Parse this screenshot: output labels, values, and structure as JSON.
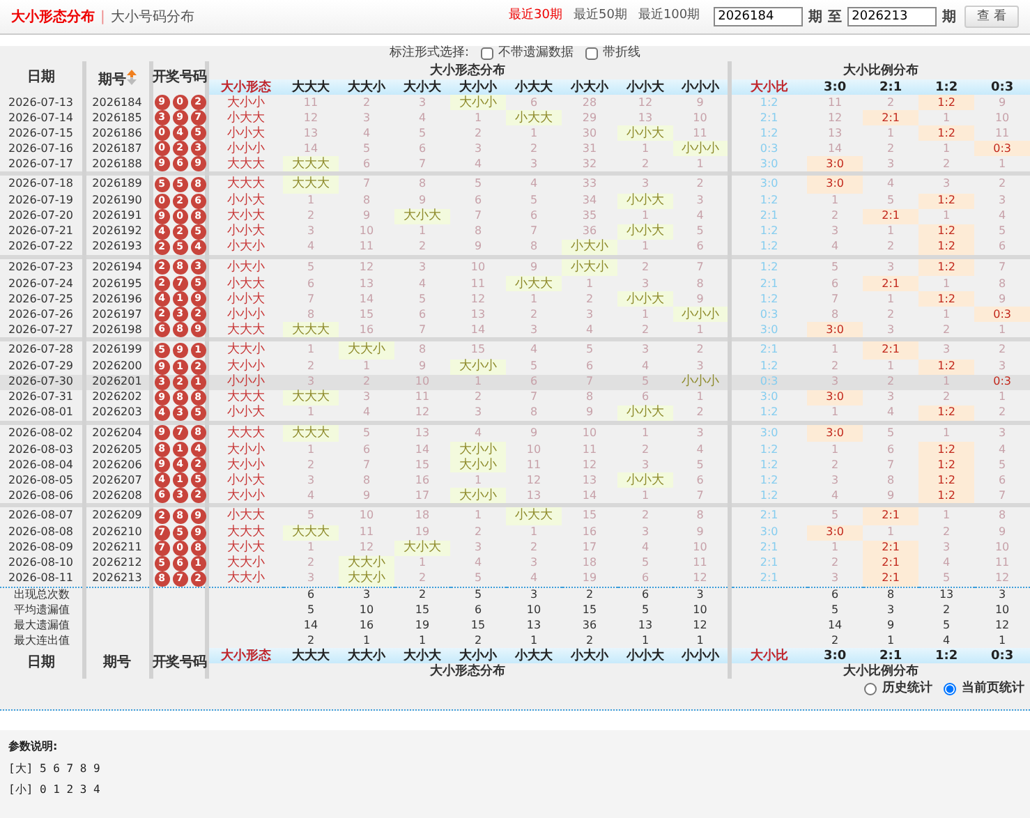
{
  "tabs": [
    {
      "label": "大小形态分布",
      "selected": true
    },
    {
      "label": "大小号码分布",
      "selected": false
    }
  ],
  "tab_separator": "|",
  "range": {
    "links": [
      {
        "label": "最近30期",
        "selected": true
      },
      {
        "label": "最近50期",
        "selected": false
      },
      {
        "label": "最近100期",
        "selected": false
      }
    ],
    "from": "2026184",
    "from_unit": "期",
    "to_label": "至",
    "to": "2026213",
    "to_unit": "期",
    "button": "查 看"
  },
  "options": {
    "label": "标注形式选择:",
    "checkboxes": [
      {
        "label": "不带遗漏数据",
        "checked": false
      },
      {
        "label": "带折线",
        "checked": false
      }
    ]
  },
  "table": {
    "date_header": "日期",
    "issue_header": "期号",
    "balls_header": "开奖号码",
    "group_1": "大小形态分布",
    "group_1_columns": [
      "大小形态",
      "大大大",
      "大大小",
      "大小大",
      "大小小",
      "小大大",
      "小大小",
      "小小大",
      "小小小"
    ],
    "group_2": "大小比例分布",
    "group_2_columns": [
      "大小比",
      "3:0",
      "2:1",
      "1:2",
      "0:3"
    ],
    "rows": [
      {
        "date": "2026-07-13",
        "issue": "2026184",
        "balls": [
          "9",
          "0",
          "2"
        ],
        "pattern": "大小小",
        "highlighted": false,
        "pattern_cells": [
          {
            "text": "11",
            "hit": false
          },
          {
            "text": "2",
            "hit": false
          },
          {
            "text": "3",
            "hit": false
          },
          {
            "text": "大小小",
            "hit": true
          },
          {
            "text": "6",
            "hit": false
          },
          {
            "text": "28",
            "hit": false
          },
          {
            "text": "12",
            "hit": false
          },
          {
            "text": "9",
            "hit": false
          }
        ],
        "ratio": "1:2",
        "ratio_cells": [
          {
            "text": "11",
            "hit": false
          },
          {
            "text": "2",
            "hit": false
          },
          {
            "text": "1:2",
            "hit": true
          },
          {
            "text": "9",
            "hit": false
          }
        ]
      },
      {
        "date": "2026-07-14",
        "issue": "2026185",
        "balls": [
          "3",
          "9",
          "7"
        ],
        "pattern": "小大大",
        "highlighted": false,
        "pattern_cells": [
          {
            "text": "12",
            "hit": false
          },
          {
            "text": "3",
            "hit": false
          },
          {
            "text": "4",
            "hit": false
          },
          {
            "text": "1",
            "hit": false
          },
          {
            "text": "小大大",
            "hit": true
          },
          {
            "text": "29",
            "hit": false
          },
          {
            "text": "13",
            "hit": false
          },
          {
            "text": "10",
            "hit": false
          }
        ],
        "ratio": "2:1",
        "ratio_cells": [
          {
            "text": "12",
            "hit": false
          },
          {
            "text": "2:1",
            "hit": true
          },
          {
            "text": "1",
            "hit": false
          },
          {
            "text": "10",
            "hit": false
          }
        ]
      },
      {
        "date": "2026-07-15",
        "issue": "2026186",
        "balls": [
          "0",
          "4",
          "5"
        ],
        "pattern": "小小大",
        "highlighted": false,
        "pattern_cells": [
          {
            "text": "13",
            "hit": false
          },
          {
            "text": "4",
            "hit": false
          },
          {
            "text": "5",
            "hit": false
          },
          {
            "text": "2",
            "hit": false
          },
          {
            "text": "1",
            "hit": false
          },
          {
            "text": "30",
            "hit": false
          },
          {
            "text": "小小大",
            "hit": true
          },
          {
            "text": "11",
            "hit": false
          }
        ],
        "ratio": "1:2",
        "ratio_cells": [
          {
            "text": "13",
            "hit": false
          },
          {
            "text": "1",
            "hit": false
          },
          {
            "text": "1:2",
            "hit": true
          },
          {
            "text": "11",
            "hit": false
          }
        ]
      },
      {
        "date": "2026-07-16",
        "issue": "2026187",
        "balls": [
          "0",
          "2",
          "3"
        ],
        "pattern": "小小小",
        "highlighted": false,
        "pattern_cells": [
          {
            "text": "14",
            "hit": false
          },
          {
            "text": "5",
            "hit": false
          },
          {
            "text": "6",
            "hit": false
          },
          {
            "text": "3",
            "hit": false
          },
          {
            "text": "2",
            "hit": false
          },
          {
            "text": "31",
            "hit": false
          },
          {
            "text": "1",
            "hit": false
          },
          {
            "text": "小小小",
            "hit": true
          }
        ],
        "ratio": "0:3",
        "ratio_cells": [
          {
            "text": "14",
            "hit": false
          },
          {
            "text": "2",
            "hit": false
          },
          {
            "text": "1",
            "hit": false
          },
          {
            "text": "0:3",
            "hit": true
          }
        ]
      },
      {
        "date": "2026-07-17",
        "issue": "2026188",
        "balls": [
          "9",
          "6",
          "9"
        ],
        "pattern": "大大大",
        "highlighted": false,
        "pattern_cells": [
          {
            "text": "大大大",
            "hit": true
          },
          {
            "text": "6",
            "hit": false
          },
          {
            "text": "7",
            "hit": false
          },
          {
            "text": "4",
            "hit": false
          },
          {
            "text": "3",
            "hit": false
          },
          {
            "text": "32",
            "hit": false
          },
          {
            "text": "2",
            "hit": false
          },
          {
            "text": "1",
            "hit": false
          }
        ],
        "ratio": "3:0",
        "ratio_cells": [
          {
            "text": "3:0",
            "hit": true
          },
          {
            "text": "3",
            "hit": false
          },
          {
            "text": "2",
            "hit": false
          },
          {
            "text": "1",
            "hit": false
          }
        ]
      },
      {
        "date": "2026-07-18",
        "issue": "2026189",
        "balls": [
          "5",
          "5",
          "8"
        ],
        "pattern": "大大大",
        "highlighted": false,
        "pattern_cells": [
          {
            "text": "大大大",
            "hit": true
          },
          {
            "text": "7",
            "hit": false
          },
          {
            "text": "8",
            "hit": false
          },
          {
            "text": "5",
            "hit": false
          },
          {
            "text": "4",
            "hit": false
          },
          {
            "text": "33",
            "hit": false
          },
          {
            "text": "3",
            "hit": false
          },
          {
            "text": "2",
            "hit": false
          }
        ],
        "ratio": "3:0",
        "ratio_cells": [
          {
            "text": "3:0",
            "hit": true
          },
          {
            "text": "4",
            "hit": false
          },
          {
            "text": "3",
            "hit": false
          },
          {
            "text": "2",
            "hit": false
          }
        ]
      },
      {
        "date": "2026-07-19",
        "issue": "2026190",
        "balls": [
          "0",
          "2",
          "6"
        ],
        "pattern": "小小大",
        "highlighted": false,
        "pattern_cells": [
          {
            "text": "1",
            "hit": false
          },
          {
            "text": "8",
            "hit": false
          },
          {
            "text": "9",
            "hit": false
          },
          {
            "text": "6",
            "hit": false
          },
          {
            "text": "5",
            "hit": false
          },
          {
            "text": "34",
            "hit": false
          },
          {
            "text": "小小大",
            "hit": true
          },
          {
            "text": "3",
            "hit": false
          }
        ],
        "ratio": "1:2",
        "ratio_cells": [
          {
            "text": "1",
            "hit": false
          },
          {
            "text": "5",
            "hit": false
          },
          {
            "text": "1:2",
            "hit": true
          },
          {
            "text": "3",
            "hit": false
          }
        ]
      },
      {
        "date": "2026-07-20",
        "issue": "2026191",
        "balls": [
          "9",
          "0",
          "8"
        ],
        "pattern": "大小大",
        "highlighted": false,
        "pattern_cells": [
          {
            "text": "2",
            "hit": false
          },
          {
            "text": "9",
            "hit": false
          },
          {
            "text": "大小大",
            "hit": true
          },
          {
            "text": "7",
            "hit": false
          },
          {
            "text": "6",
            "hit": false
          },
          {
            "text": "35",
            "hit": false
          },
          {
            "text": "1",
            "hit": false
          },
          {
            "text": "4",
            "hit": false
          }
        ],
        "ratio": "2:1",
        "ratio_cells": [
          {
            "text": "2",
            "hit": false
          },
          {
            "text": "2:1",
            "hit": true
          },
          {
            "text": "1",
            "hit": false
          },
          {
            "text": "4",
            "hit": false
          }
        ]
      },
      {
        "date": "2026-07-21",
        "issue": "2026192",
        "balls": [
          "4",
          "2",
          "5"
        ],
        "pattern": "小小大",
        "highlighted": false,
        "pattern_cells": [
          {
            "text": "3",
            "hit": false
          },
          {
            "text": "10",
            "hit": false
          },
          {
            "text": "1",
            "hit": false
          },
          {
            "text": "8",
            "hit": false
          },
          {
            "text": "7",
            "hit": false
          },
          {
            "text": "36",
            "hit": false
          },
          {
            "text": "小小大",
            "hit": true
          },
          {
            "text": "5",
            "hit": false
          }
        ],
        "ratio": "1:2",
        "ratio_cells": [
          {
            "text": "3",
            "hit": false
          },
          {
            "text": "1",
            "hit": false
          },
          {
            "text": "1:2",
            "hit": true
          },
          {
            "text": "5",
            "hit": false
          }
        ]
      },
      {
        "date": "2026-07-22",
        "issue": "2026193",
        "balls": [
          "2",
          "5",
          "4"
        ],
        "pattern": "小大小",
        "highlighted": false,
        "pattern_cells": [
          {
            "text": "4",
            "hit": false
          },
          {
            "text": "11",
            "hit": false
          },
          {
            "text": "2",
            "hit": false
          },
          {
            "text": "9",
            "hit": false
          },
          {
            "text": "8",
            "hit": false
          },
          {
            "text": "小大小",
            "hit": true
          },
          {
            "text": "1",
            "hit": false
          },
          {
            "text": "6",
            "hit": false
          }
        ],
        "ratio": "1:2",
        "ratio_cells": [
          {
            "text": "4",
            "hit": false
          },
          {
            "text": "2",
            "hit": false
          },
          {
            "text": "1:2",
            "hit": true
          },
          {
            "text": "6",
            "hit": false
          }
        ]
      },
      {
        "date": "2026-07-23",
        "issue": "2026194",
        "balls": [
          "2",
          "8",
          "3"
        ],
        "pattern": "小大小",
        "highlighted": false,
        "pattern_cells": [
          {
            "text": "5",
            "hit": false
          },
          {
            "text": "12",
            "hit": false
          },
          {
            "text": "3",
            "hit": false
          },
          {
            "text": "10",
            "hit": false
          },
          {
            "text": "9",
            "hit": false
          },
          {
            "text": "小大小",
            "hit": true
          },
          {
            "text": "2",
            "hit": false
          },
          {
            "text": "7",
            "hit": false
          }
        ],
        "ratio": "1:2",
        "ratio_cells": [
          {
            "text": "5",
            "hit": false
          },
          {
            "text": "3",
            "hit": false
          },
          {
            "text": "1:2",
            "hit": true
          },
          {
            "text": "7",
            "hit": false
          }
        ]
      },
      {
        "date": "2026-07-24",
        "issue": "2026195",
        "balls": [
          "2",
          "7",
          "5"
        ],
        "pattern": "小大大",
        "highlighted": false,
        "pattern_cells": [
          {
            "text": "6",
            "hit": false
          },
          {
            "text": "13",
            "hit": false
          },
          {
            "text": "4",
            "hit": false
          },
          {
            "text": "11",
            "hit": false
          },
          {
            "text": "小大大",
            "hit": true
          },
          {
            "text": "1",
            "hit": false
          },
          {
            "text": "3",
            "hit": false
          },
          {
            "text": "8",
            "hit": false
          }
        ],
        "ratio": "2:1",
        "ratio_cells": [
          {
            "text": "6",
            "hit": false
          },
          {
            "text": "2:1",
            "hit": true
          },
          {
            "text": "1",
            "hit": false
          },
          {
            "text": "8",
            "hit": false
          }
        ]
      },
      {
        "date": "2026-07-25",
        "issue": "2026196",
        "balls": [
          "4",
          "1",
          "9"
        ],
        "pattern": "小小大",
        "highlighted": false,
        "pattern_cells": [
          {
            "text": "7",
            "hit": false
          },
          {
            "text": "14",
            "hit": false
          },
          {
            "text": "5",
            "hit": false
          },
          {
            "text": "12",
            "hit": false
          },
          {
            "text": "1",
            "hit": false
          },
          {
            "text": "2",
            "hit": false
          },
          {
            "text": "小小大",
            "hit": true
          },
          {
            "text": "9",
            "hit": false
          }
        ],
        "ratio": "1:2",
        "ratio_cells": [
          {
            "text": "7",
            "hit": false
          },
          {
            "text": "1",
            "hit": false
          },
          {
            "text": "1:2",
            "hit": true
          },
          {
            "text": "9",
            "hit": false
          }
        ]
      },
      {
        "date": "2026-07-26",
        "issue": "2026197",
        "balls": [
          "2",
          "3",
          "2"
        ],
        "pattern": "小小小",
        "highlighted": false,
        "pattern_cells": [
          {
            "text": "8",
            "hit": false
          },
          {
            "text": "15",
            "hit": false
          },
          {
            "text": "6",
            "hit": false
          },
          {
            "text": "13",
            "hit": false
          },
          {
            "text": "2",
            "hit": false
          },
          {
            "text": "3",
            "hit": false
          },
          {
            "text": "1",
            "hit": false
          },
          {
            "text": "小小小",
            "hit": true
          }
        ],
        "ratio": "0:3",
        "ratio_cells": [
          {
            "text": "8",
            "hit": false
          },
          {
            "text": "2",
            "hit": false
          },
          {
            "text": "1",
            "hit": false
          },
          {
            "text": "0:3",
            "hit": true
          }
        ]
      },
      {
        "date": "2026-07-27",
        "issue": "2026198",
        "balls": [
          "6",
          "8",
          "9"
        ],
        "pattern": "大大大",
        "highlighted": false,
        "pattern_cells": [
          {
            "text": "大大大",
            "hit": true
          },
          {
            "text": "16",
            "hit": false
          },
          {
            "text": "7",
            "hit": false
          },
          {
            "text": "14",
            "hit": false
          },
          {
            "text": "3",
            "hit": false
          },
          {
            "text": "4",
            "hit": false
          },
          {
            "text": "2",
            "hit": false
          },
          {
            "text": "1",
            "hit": false
          }
        ],
        "ratio": "3:0",
        "ratio_cells": [
          {
            "text": "3:0",
            "hit": true
          },
          {
            "text": "3",
            "hit": false
          },
          {
            "text": "2",
            "hit": false
          },
          {
            "text": "1",
            "hit": false
          }
        ]
      },
      {
        "date": "2026-07-28",
        "issue": "2026199",
        "balls": [
          "5",
          "9",
          "1"
        ],
        "pattern": "大大小",
        "highlighted": false,
        "pattern_cells": [
          {
            "text": "1",
            "hit": false
          },
          {
            "text": "大大小",
            "hit": true
          },
          {
            "text": "8",
            "hit": false
          },
          {
            "text": "15",
            "hit": false
          },
          {
            "text": "4",
            "hit": false
          },
          {
            "text": "5",
            "hit": false
          },
          {
            "text": "3",
            "hit": false
          },
          {
            "text": "2",
            "hit": false
          }
        ],
        "ratio": "2:1",
        "ratio_cells": [
          {
            "text": "1",
            "hit": false
          },
          {
            "text": "2:1",
            "hit": true
          },
          {
            "text": "3",
            "hit": false
          },
          {
            "text": "2",
            "hit": false
          }
        ]
      },
      {
        "date": "2026-07-29",
        "issue": "2026200",
        "balls": [
          "9",
          "1",
          "2"
        ],
        "pattern": "大小小",
        "highlighted": false,
        "pattern_cells": [
          {
            "text": "2",
            "hit": false
          },
          {
            "text": "1",
            "hit": false
          },
          {
            "text": "9",
            "hit": false
          },
          {
            "text": "大小小",
            "hit": true
          },
          {
            "text": "5",
            "hit": false
          },
          {
            "text": "6",
            "hit": false
          },
          {
            "text": "4",
            "hit": false
          },
          {
            "text": "3",
            "hit": false
          }
        ],
        "ratio": "1:2",
        "ratio_cells": [
          {
            "text": "2",
            "hit": false
          },
          {
            "text": "1",
            "hit": false
          },
          {
            "text": "1:2",
            "hit": true
          },
          {
            "text": "3",
            "hit": false
          }
        ]
      },
      {
        "date": "2026-07-30",
        "issue": "2026201",
        "balls": [
          "3",
          "2",
          "1"
        ],
        "pattern": "小小小",
        "highlighted": true,
        "pattern_cells": [
          {
            "text": "3",
            "hit": false
          },
          {
            "text": "2",
            "hit": false
          },
          {
            "text": "10",
            "hit": false
          },
          {
            "text": "1",
            "hit": false
          },
          {
            "text": "6",
            "hit": false
          },
          {
            "text": "7",
            "hit": false
          },
          {
            "text": "5",
            "hit": false
          },
          {
            "text": "小小小",
            "hit": true
          }
        ],
        "ratio": "0:3",
        "ratio_cells": [
          {
            "text": "3",
            "hit": false
          },
          {
            "text": "2",
            "hit": false
          },
          {
            "text": "1",
            "hit": false
          },
          {
            "text": "0:3",
            "hit": true
          }
        ]
      },
      {
        "date": "2026-07-31",
        "issue": "2026202",
        "balls": [
          "9",
          "8",
          "8"
        ],
        "pattern": "大大大",
        "highlighted": false,
        "pattern_cells": [
          {
            "text": "大大大",
            "hit": true
          },
          {
            "text": "3",
            "hit": false
          },
          {
            "text": "11",
            "hit": false
          },
          {
            "text": "2",
            "hit": false
          },
          {
            "text": "7",
            "hit": false
          },
          {
            "text": "8",
            "hit": false
          },
          {
            "text": "6",
            "hit": false
          },
          {
            "text": "1",
            "hit": false
          }
        ],
        "ratio": "3:0",
        "ratio_cells": [
          {
            "text": "3:0",
            "hit": true
          },
          {
            "text": "3",
            "hit": false
          },
          {
            "text": "2",
            "hit": false
          },
          {
            "text": "1",
            "hit": false
          }
        ]
      },
      {
        "date": "2026-08-01",
        "issue": "2026203",
        "balls": [
          "4",
          "3",
          "5"
        ],
        "pattern": "小小大",
        "highlighted": false,
        "pattern_cells": [
          {
            "text": "1",
            "hit": false
          },
          {
            "text": "4",
            "hit": false
          },
          {
            "text": "12",
            "hit": false
          },
          {
            "text": "3",
            "hit": false
          },
          {
            "text": "8",
            "hit": false
          },
          {
            "text": "9",
            "hit": false
          },
          {
            "text": "小小大",
            "hit": true
          },
          {
            "text": "2",
            "hit": false
          }
        ],
        "ratio": "1:2",
        "ratio_cells": [
          {
            "text": "1",
            "hit": false
          },
          {
            "text": "4",
            "hit": false
          },
          {
            "text": "1:2",
            "hit": true
          },
          {
            "text": "2",
            "hit": false
          }
        ]
      },
      {
        "date": "2026-08-02",
        "issue": "2026204",
        "balls": [
          "9",
          "7",
          "8"
        ],
        "pattern": "大大大",
        "highlighted": false,
        "pattern_cells": [
          {
            "text": "大大大",
            "hit": true
          },
          {
            "text": "5",
            "hit": false
          },
          {
            "text": "13",
            "hit": false
          },
          {
            "text": "4",
            "hit": false
          },
          {
            "text": "9",
            "hit": false
          },
          {
            "text": "10",
            "hit": false
          },
          {
            "text": "1",
            "hit": false
          },
          {
            "text": "3",
            "hit": false
          }
        ],
        "ratio": "3:0",
        "ratio_cells": [
          {
            "text": "3:0",
            "hit": true
          },
          {
            "text": "5",
            "hit": false
          },
          {
            "text": "1",
            "hit": false
          },
          {
            "text": "3",
            "hit": false
          }
        ]
      },
      {
        "date": "2026-08-03",
        "issue": "2026205",
        "balls": [
          "8",
          "1",
          "4"
        ],
        "pattern": "大小小",
        "highlighted": false,
        "pattern_cells": [
          {
            "text": "1",
            "hit": false
          },
          {
            "text": "6",
            "hit": false
          },
          {
            "text": "14",
            "hit": false
          },
          {
            "text": "大小小",
            "hit": true
          },
          {
            "text": "10",
            "hit": false
          },
          {
            "text": "11",
            "hit": false
          },
          {
            "text": "2",
            "hit": false
          },
          {
            "text": "4",
            "hit": false
          }
        ],
        "ratio": "1:2",
        "ratio_cells": [
          {
            "text": "1",
            "hit": false
          },
          {
            "text": "6",
            "hit": false
          },
          {
            "text": "1:2",
            "hit": true
          },
          {
            "text": "4",
            "hit": false
          }
        ]
      },
      {
        "date": "2026-08-04",
        "issue": "2026206",
        "balls": [
          "9",
          "4",
          "2"
        ],
        "pattern": "大小小",
        "highlighted": false,
        "pattern_cells": [
          {
            "text": "2",
            "hit": false
          },
          {
            "text": "7",
            "hit": false
          },
          {
            "text": "15",
            "hit": false
          },
          {
            "text": "大小小",
            "hit": true
          },
          {
            "text": "11",
            "hit": false
          },
          {
            "text": "12",
            "hit": false
          },
          {
            "text": "3",
            "hit": false
          },
          {
            "text": "5",
            "hit": false
          }
        ],
        "ratio": "1:2",
        "ratio_cells": [
          {
            "text": "2",
            "hit": false
          },
          {
            "text": "7",
            "hit": false
          },
          {
            "text": "1:2",
            "hit": true
          },
          {
            "text": "5",
            "hit": false
          }
        ]
      },
      {
        "date": "2026-08-05",
        "issue": "2026207",
        "balls": [
          "4",
          "1",
          "5"
        ],
        "pattern": "小小大",
        "highlighted": false,
        "pattern_cells": [
          {
            "text": "3",
            "hit": false
          },
          {
            "text": "8",
            "hit": false
          },
          {
            "text": "16",
            "hit": false
          },
          {
            "text": "1",
            "hit": false
          },
          {
            "text": "12",
            "hit": false
          },
          {
            "text": "13",
            "hit": false
          },
          {
            "text": "小小大",
            "hit": true
          },
          {
            "text": "6",
            "hit": false
          }
        ],
        "ratio": "1:2",
        "ratio_cells": [
          {
            "text": "3",
            "hit": false
          },
          {
            "text": "8",
            "hit": false
          },
          {
            "text": "1:2",
            "hit": true
          },
          {
            "text": "6",
            "hit": false
          }
        ]
      },
      {
        "date": "2026-08-06",
        "issue": "2026208",
        "balls": [
          "6",
          "3",
          "2"
        ],
        "pattern": "大小小",
        "highlighted": false,
        "pattern_cells": [
          {
            "text": "4",
            "hit": false
          },
          {
            "text": "9",
            "hit": false
          },
          {
            "text": "17",
            "hit": false
          },
          {
            "text": "大小小",
            "hit": true
          },
          {
            "text": "13",
            "hit": false
          },
          {
            "text": "14",
            "hit": false
          },
          {
            "text": "1",
            "hit": false
          },
          {
            "text": "7",
            "hit": false
          }
        ],
        "ratio": "1:2",
        "ratio_cells": [
          {
            "text": "4",
            "hit": false
          },
          {
            "text": "9",
            "hit": false
          },
          {
            "text": "1:2",
            "hit": true
          },
          {
            "text": "7",
            "hit": false
          }
        ]
      },
      {
        "date": "2026-08-07",
        "issue": "2026209",
        "balls": [
          "2",
          "8",
          "9"
        ],
        "pattern": "小大大",
        "highlighted": false,
        "pattern_cells": [
          {
            "text": "5",
            "hit": false
          },
          {
            "text": "10",
            "hit": false
          },
          {
            "text": "18",
            "hit": false
          },
          {
            "text": "1",
            "hit": false
          },
          {
            "text": "小大大",
            "hit": true
          },
          {
            "text": "15",
            "hit": false
          },
          {
            "text": "2",
            "hit": false
          },
          {
            "text": "8",
            "hit": false
          }
        ],
        "ratio": "2:1",
        "ratio_cells": [
          {
            "text": "5",
            "hit": false
          },
          {
            "text": "2:1",
            "hit": true
          },
          {
            "text": "1",
            "hit": false
          },
          {
            "text": "8",
            "hit": false
          }
        ]
      },
      {
        "date": "2026-08-08",
        "issue": "2026210",
        "balls": [
          "7",
          "5",
          "9"
        ],
        "pattern": "大大大",
        "highlighted": false,
        "pattern_cells": [
          {
            "text": "大大大",
            "hit": true
          },
          {
            "text": "11",
            "hit": false
          },
          {
            "text": "19",
            "hit": false
          },
          {
            "text": "2",
            "hit": false
          },
          {
            "text": "1",
            "hit": false
          },
          {
            "text": "16",
            "hit": false
          },
          {
            "text": "3",
            "hit": false
          },
          {
            "text": "9",
            "hit": false
          }
        ],
        "ratio": "3:0",
        "ratio_cells": [
          {
            "text": "3:0",
            "hit": true
          },
          {
            "text": "1",
            "hit": false
          },
          {
            "text": "2",
            "hit": false
          },
          {
            "text": "9",
            "hit": false
          }
        ]
      },
      {
        "date": "2026-08-09",
        "issue": "2026211",
        "balls": [
          "7",
          "0",
          "8"
        ],
        "pattern": "大小大",
        "highlighted": false,
        "pattern_cells": [
          {
            "text": "1",
            "hit": false
          },
          {
            "text": "12",
            "hit": false
          },
          {
            "text": "大小大",
            "hit": true
          },
          {
            "text": "3",
            "hit": false
          },
          {
            "text": "2",
            "hit": false
          },
          {
            "text": "17",
            "hit": false
          },
          {
            "text": "4",
            "hit": false
          },
          {
            "text": "10",
            "hit": false
          }
        ],
        "ratio": "2:1",
        "ratio_cells": [
          {
            "text": "1",
            "hit": false
          },
          {
            "text": "2:1",
            "hit": true
          },
          {
            "text": "3",
            "hit": false
          },
          {
            "text": "10",
            "hit": false
          }
        ]
      },
      {
        "date": "2026-08-10",
        "issue": "2026212",
        "balls": [
          "5",
          "6",
          "1"
        ],
        "pattern": "大大小",
        "highlighted": false,
        "pattern_cells": [
          {
            "text": "2",
            "hit": false
          },
          {
            "text": "大大小",
            "hit": true
          },
          {
            "text": "1",
            "hit": false
          },
          {
            "text": "4",
            "hit": false
          },
          {
            "text": "3",
            "hit": false
          },
          {
            "text": "18",
            "hit": false
          },
          {
            "text": "5",
            "hit": false
          },
          {
            "text": "11",
            "hit": false
          }
        ],
        "ratio": "2:1",
        "ratio_cells": [
          {
            "text": "2",
            "hit": false
          },
          {
            "text": "2:1",
            "hit": true
          },
          {
            "text": "4",
            "hit": false
          },
          {
            "text": "11",
            "hit": false
          }
        ]
      },
      {
        "date": "2026-08-11",
        "issue": "2026213",
        "balls": [
          "8",
          "7",
          "2"
        ],
        "pattern": "大大小",
        "highlighted": false,
        "pattern_cells": [
          {
            "text": "3",
            "hit": false
          },
          {
            "text": "大大小",
            "hit": true
          },
          {
            "text": "2",
            "hit": false
          },
          {
            "text": "5",
            "hit": false
          },
          {
            "text": "4",
            "hit": false
          },
          {
            "text": "19",
            "hit": false
          },
          {
            "text": "6",
            "hit": false
          },
          {
            "text": "12",
            "hit": false
          }
        ],
        "ratio": "2:1",
        "ratio_cells": [
          {
            "text": "3",
            "hit": false
          },
          {
            "text": "2:1",
            "hit": true
          },
          {
            "text": "5",
            "hit": false
          },
          {
            "text": "12",
            "hit": false
          }
        ]
      }
    ],
    "stats": [
      {
        "label": "出现总次数",
        "pattern_values": [
          "6",
          "3",
          "2",
          "5",
          "3",
          "2",
          "6",
          "3"
        ],
        "ratio_values": [
          "6",
          "8",
          "13",
          "3"
        ]
      },
      {
        "label": "平均遗漏值",
        "pattern_values": [
          "5",
          "10",
          "15",
          "6",
          "10",
          "15",
          "5",
          "10"
        ],
        "ratio_values": [
          "5",
          "3",
          "2",
          "10"
        ]
      },
      {
        "label": "最大遗漏值",
        "pattern_values": [
          "14",
          "16",
          "19",
          "15",
          "13",
          "36",
          "13",
          "12"
        ],
        "ratio_values": [
          "14",
          "9",
          "5",
          "12"
        ]
      },
      {
        "label": "最大连出值",
        "pattern_values": [
          "2",
          "1",
          "1",
          "2",
          "1",
          "2",
          "1",
          "1"
        ],
        "ratio_values": [
          "2",
          "1",
          "4",
          "1"
        ]
      }
    ],
    "footer": {
      "date_header": "日期",
      "issue_header": "期号",
      "balls_header": "开奖号码",
      "group_1_columns": [
        "大小形态",
        "大大大",
        "大大小",
        "大小大",
        "大小小",
        "小大大",
        "小大小",
        "小小大",
        "小小小"
      ],
      "group_1": "大小形态分布",
      "group_2_columns": [
        "大小比",
        "3:0",
        "2:1",
        "1:2",
        "0:3"
      ],
      "group_2": "大小比例分布"
    }
  },
  "stat_modes": [
    {
      "label": "历史统计",
      "selected": false
    },
    {
      "label": "当前页统计",
      "selected": true
    }
  ],
  "notes": {
    "title": "参数说明:",
    "lines": [
      "[大] 5 6 7 8 9",
      "[小] 0 1 2 3 4"
    ]
  }
}
